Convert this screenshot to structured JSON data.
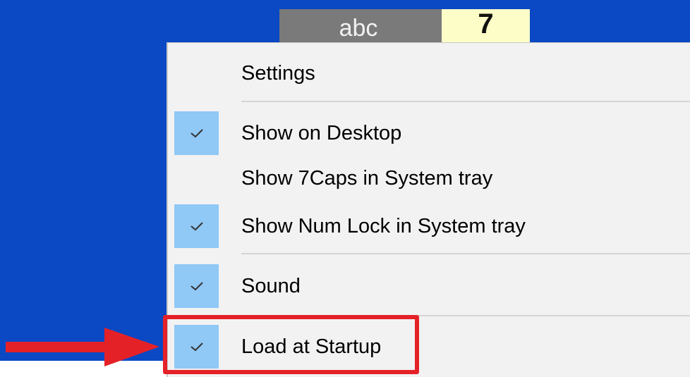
{
  "tray_widget": {
    "caps_text": "abc",
    "num_text": "7"
  },
  "menu": {
    "items": [
      {
        "label": "Settings",
        "checked": false
      },
      {
        "label": "Show on Desktop",
        "checked": true
      },
      {
        "label": "Show 7Caps in System tray",
        "checked": false
      },
      {
        "label": "Show Num Lock in System tray",
        "checked": true
      },
      {
        "label": "Sound",
        "checked": true
      },
      {
        "label": "Load at Startup",
        "checked": true
      }
    ]
  },
  "colors": {
    "desktop": "#0a48c4",
    "menu_background": "#f2f2f2",
    "check_highlight": "#90c8f6",
    "annotation": "#e52128"
  },
  "icons": {
    "check": "check-icon",
    "arrow": "red-arrow-icon"
  }
}
